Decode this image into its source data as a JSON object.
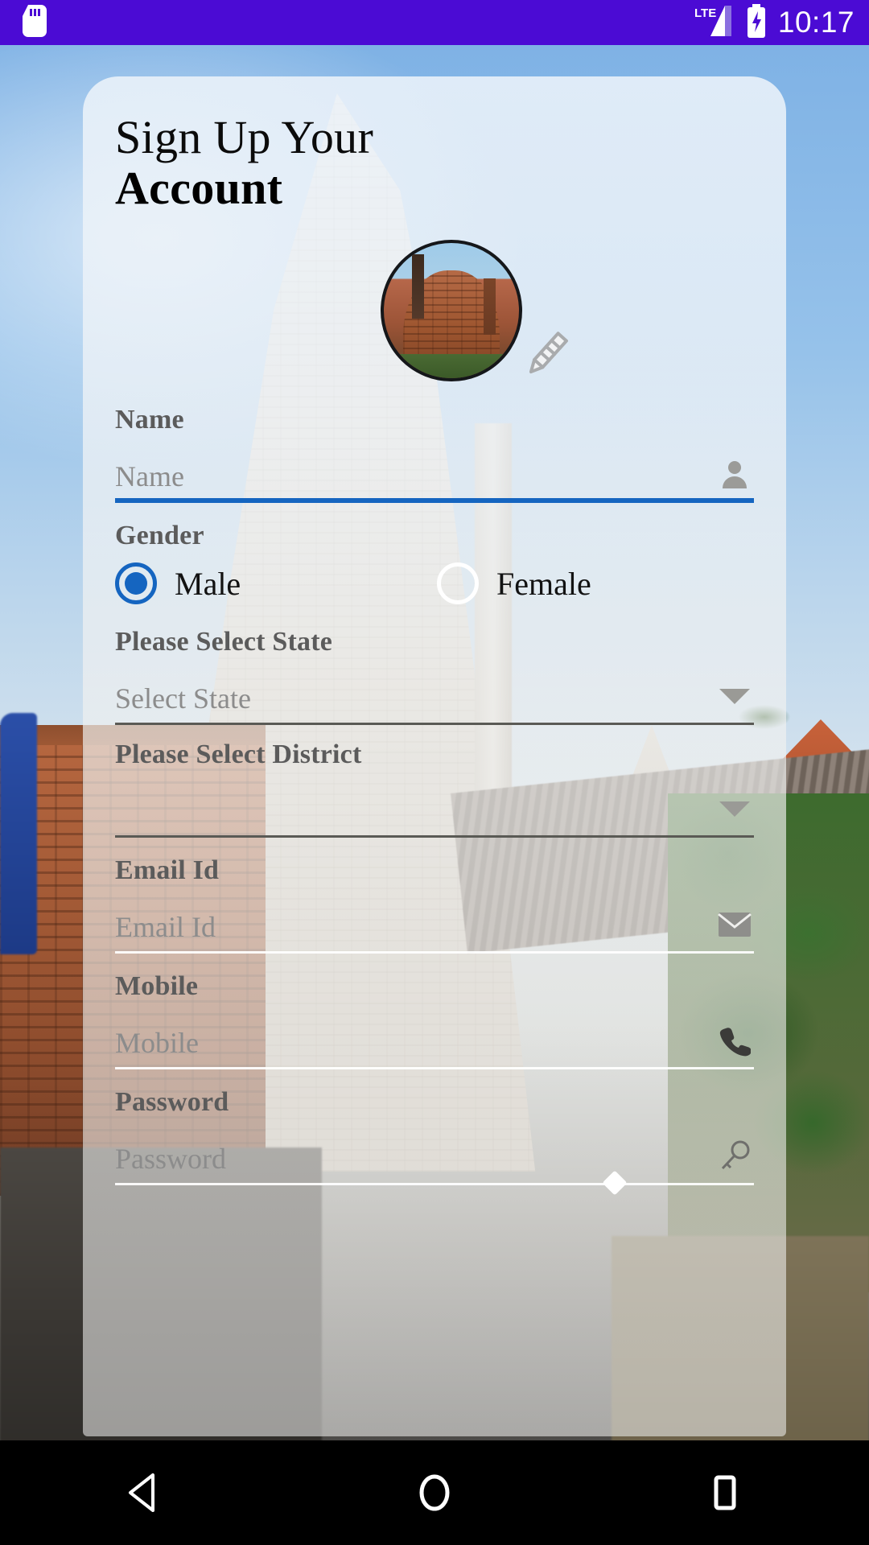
{
  "status_bar": {
    "time": "10:17",
    "network_label": "LTE",
    "icons": [
      "sd-card-icon",
      "lte-signal-icon",
      "battery-charging-icon"
    ],
    "background_color": "#4b0bd4"
  },
  "card": {
    "title_line1": "Sign Up Your",
    "title_line2": "Account",
    "avatar": {
      "name": "profile-avatar",
      "edit_icon": "pencil-edit-icon"
    },
    "fields": [
      {
        "name": "name",
        "label": "Name",
        "placeholder": "Name",
        "value": "",
        "icon": "person-icon",
        "underline": "blue",
        "type": "text"
      },
      {
        "name": "state",
        "label": "Please Select State",
        "placeholder": "Select State",
        "value": "Select State",
        "icon": "chevron-down-icon",
        "underline": "dark",
        "type": "spinner"
      },
      {
        "name": "district",
        "label": "Please Select District",
        "placeholder": "",
        "value": "",
        "icon": "chevron-down-icon",
        "underline": "dark",
        "type": "spinner"
      },
      {
        "name": "email",
        "label": "Email Id",
        "placeholder": "Email Id",
        "value": "",
        "icon": "envelope-icon",
        "underline": "light",
        "type": "email"
      },
      {
        "name": "mobile",
        "label": "Mobile",
        "placeholder": "Mobile",
        "value": "",
        "icon": "phone-icon",
        "underline": "light",
        "type": "tel"
      },
      {
        "name": "password",
        "label": "Password",
        "placeholder": "Password",
        "value": "",
        "icon": "key-icon",
        "underline": "light",
        "type": "password"
      }
    ],
    "gender": {
      "label": "Gender",
      "options": [
        {
          "label": "Male",
          "selected": true
        },
        {
          "label": "Female",
          "selected": false
        }
      ]
    }
  },
  "nav_bar": {
    "buttons": [
      {
        "name": "back-button",
        "icon": "triangle-back-icon"
      },
      {
        "name": "home-button",
        "icon": "circle-home-icon"
      },
      {
        "name": "recents-button",
        "icon": "square-recents-icon"
      }
    ]
  },
  "colors": {
    "status_bar": "#4b0bd4",
    "accent_blue": "#1565c0",
    "label_gray": "#5b5b5b",
    "placeholder_gray": "#8c8c8c"
  }
}
